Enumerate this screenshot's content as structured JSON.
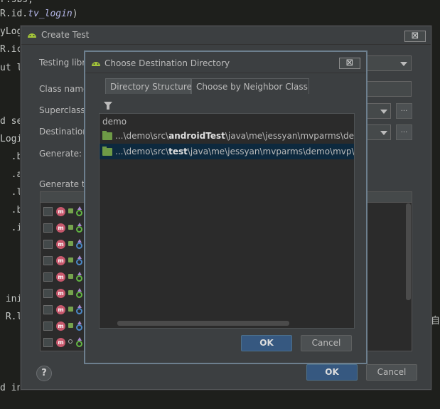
{
  "editor": {
    "lines": [
      {
        "pre": "R.id.",
        "field": "tv_login",
        "post": ")"
      },
      {
        "pre": "yLog",
        "field": "",
        "post": ""
      },
      {
        "pre": "R.ic",
        "field": "",
        "post": ""
      },
      {
        "pre": "ut l",
        "field": "",
        "post": ""
      },
      {
        "pre": "d se",
        "field": "",
        "post": ""
      },
      {
        "pre": "Logi",
        "field": "",
        "post": ""
      },
      {
        "pre": "  .b",
        "field": "",
        "post": ""
      },
      {
        "pre": "  .a",
        "field": "",
        "post": ""
      },
      {
        "pre": "  .l",
        "field": "",
        "post": ""
      },
      {
        "pre": "  .b",
        "field": "",
        "post": ""
      },
      {
        "pre": "  .i",
        "field": "",
        "post": ""
      },
      {
        "pre": " ini",
        "field": "",
        "post": ""
      },
      {
        "pre": " R.l",
        "field": "",
        "post": ""
      },
      {
        "pre": "d in",
        "field": "",
        "post": ""
      }
    ],
    "edge_char": "自"
  },
  "create_test": {
    "title": "Create Test",
    "close_glyph": "⊠",
    "labels": {
      "testing_library": "Testing libr",
      "class_name": "Class name",
      "superclass": "Superclass",
      "destination": "Destination",
      "generate": "Generate:",
      "generate_test": "Generate t"
    },
    "dots": "...",
    "help": "?",
    "ok": "OK",
    "cancel": "Cancel"
  },
  "choose_dir": {
    "title": "Choose Destination Directory",
    "close_glyph": "⊠",
    "tabs": [
      "Directory Structure",
      "Choose by Neighbor Class"
    ],
    "active_tab": 0,
    "root": "demo",
    "rows": [
      {
        "prefix": "...\\demo\\src\\",
        "bold": "androidTest",
        "suffix": "\\java\\me\\jessyan\\mvparms\\dem",
        "selected": false
      },
      {
        "prefix": "...\\demo\\src\\",
        "bold": "test",
        "suffix": "\\java\\me\\jessyan\\mvparms\\demo\\mvp\\u",
        "selected": true
      }
    ],
    "ok": "OK",
    "cancel": "Cancel"
  },
  "colors": {
    "accent": "#365880",
    "selection": "#0d293e",
    "folder": "#6e9a46",
    "method_badge": "#c7586c"
  }
}
